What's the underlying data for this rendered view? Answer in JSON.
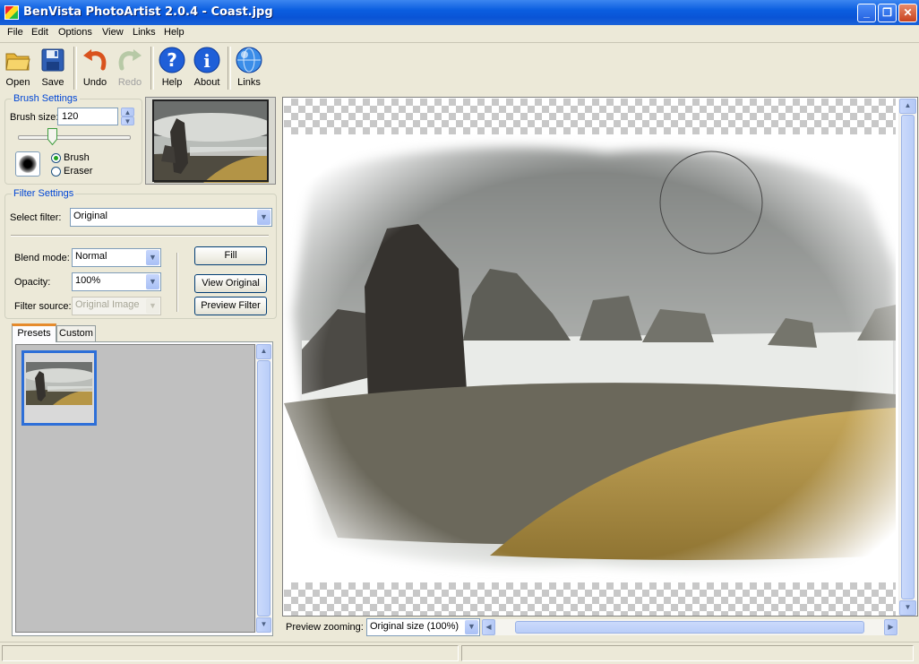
{
  "window": {
    "title": "BenVista PhotoArtist 2.0.4 - Coast.jpg"
  },
  "menu": [
    "File",
    "Edit",
    "Options",
    "View",
    "Links",
    "Help"
  ],
  "toolbar": {
    "open": "Open",
    "save": "Save",
    "undo": "Undo",
    "redo": "Redo",
    "help": "Help",
    "about": "About",
    "links": "Links"
  },
  "brush_settings": {
    "title": "Brush Settings",
    "size_label": "Brush size:",
    "size_value": "120",
    "brush_label": "Brush",
    "eraser_label": "Eraser",
    "selected_mode": "Brush"
  },
  "filter_settings": {
    "title": "Filter Settings",
    "select_label": "Select filter:",
    "select_value": "Original",
    "blend_label": "Blend mode:",
    "blend_value": "Normal",
    "opacity_label": "Opacity:",
    "opacity_value": "100%",
    "source_label": "Filter source:",
    "source_value": "Original Image",
    "fill_button": "Fill",
    "view_original_button": "View Original",
    "preview_filter_button": "Preview Filter"
  },
  "tabs": {
    "presets": "Presets",
    "custom": "Custom",
    "active": "Presets"
  },
  "preview": {
    "zoom_label": "Preview zooming:",
    "zoom_value": "Original size (100%)"
  },
  "icons": {
    "open": "folder-open-icon",
    "save": "floppy-disk-icon",
    "undo": "undo-arrow-icon",
    "redo": "redo-arrow-icon",
    "help": "question-mark-icon",
    "about": "info-icon",
    "links": "globe-icon"
  }
}
